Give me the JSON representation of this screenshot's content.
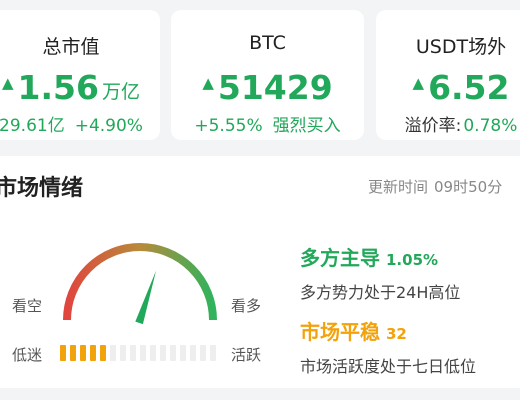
{
  "cards": {
    "total": {
      "label": "总市值",
      "value": "1.56",
      "unit": "万亿",
      "sub_left": "29.61亿",
      "sub_right": "+4.90%"
    },
    "btc": {
      "label": "BTC",
      "value": "51429",
      "sub_left": "+5.55%",
      "sub_right": "强烈买入"
    },
    "usdt": {
      "label": "USDT场外",
      "value": "6.52",
      "sub_label": "溢价率:",
      "sub_value": "0.78%"
    },
    "up_arrow_icon": "triangle-up",
    "up_color": "#21a85a"
  },
  "sentiment": {
    "title": "市场情绪",
    "updated_label": "更新时间",
    "updated_time": "09时50分",
    "gauge_labels": {
      "bear": "看空",
      "bull": "看多",
      "low": "低迷",
      "high": "活跃"
    },
    "gauge_needle_level": 0.6,
    "activity_bars_total": 16,
    "activity_bars_filled": 5,
    "colors": {
      "bull_green": "#21a85a",
      "activity_orange": "#f2a20a",
      "bar_empty": "#eeeeee",
      "gauge_red": "#e0463e",
      "gauge_green": "#2fb35c"
    },
    "bull_status": {
      "title": "多方主导",
      "value": "1.05%",
      "desc": "多方势力处于24H高位"
    },
    "activity_status": {
      "title": "市场平稳",
      "value": "32",
      "desc": "市场活跃度处于七日低位"
    }
  }
}
